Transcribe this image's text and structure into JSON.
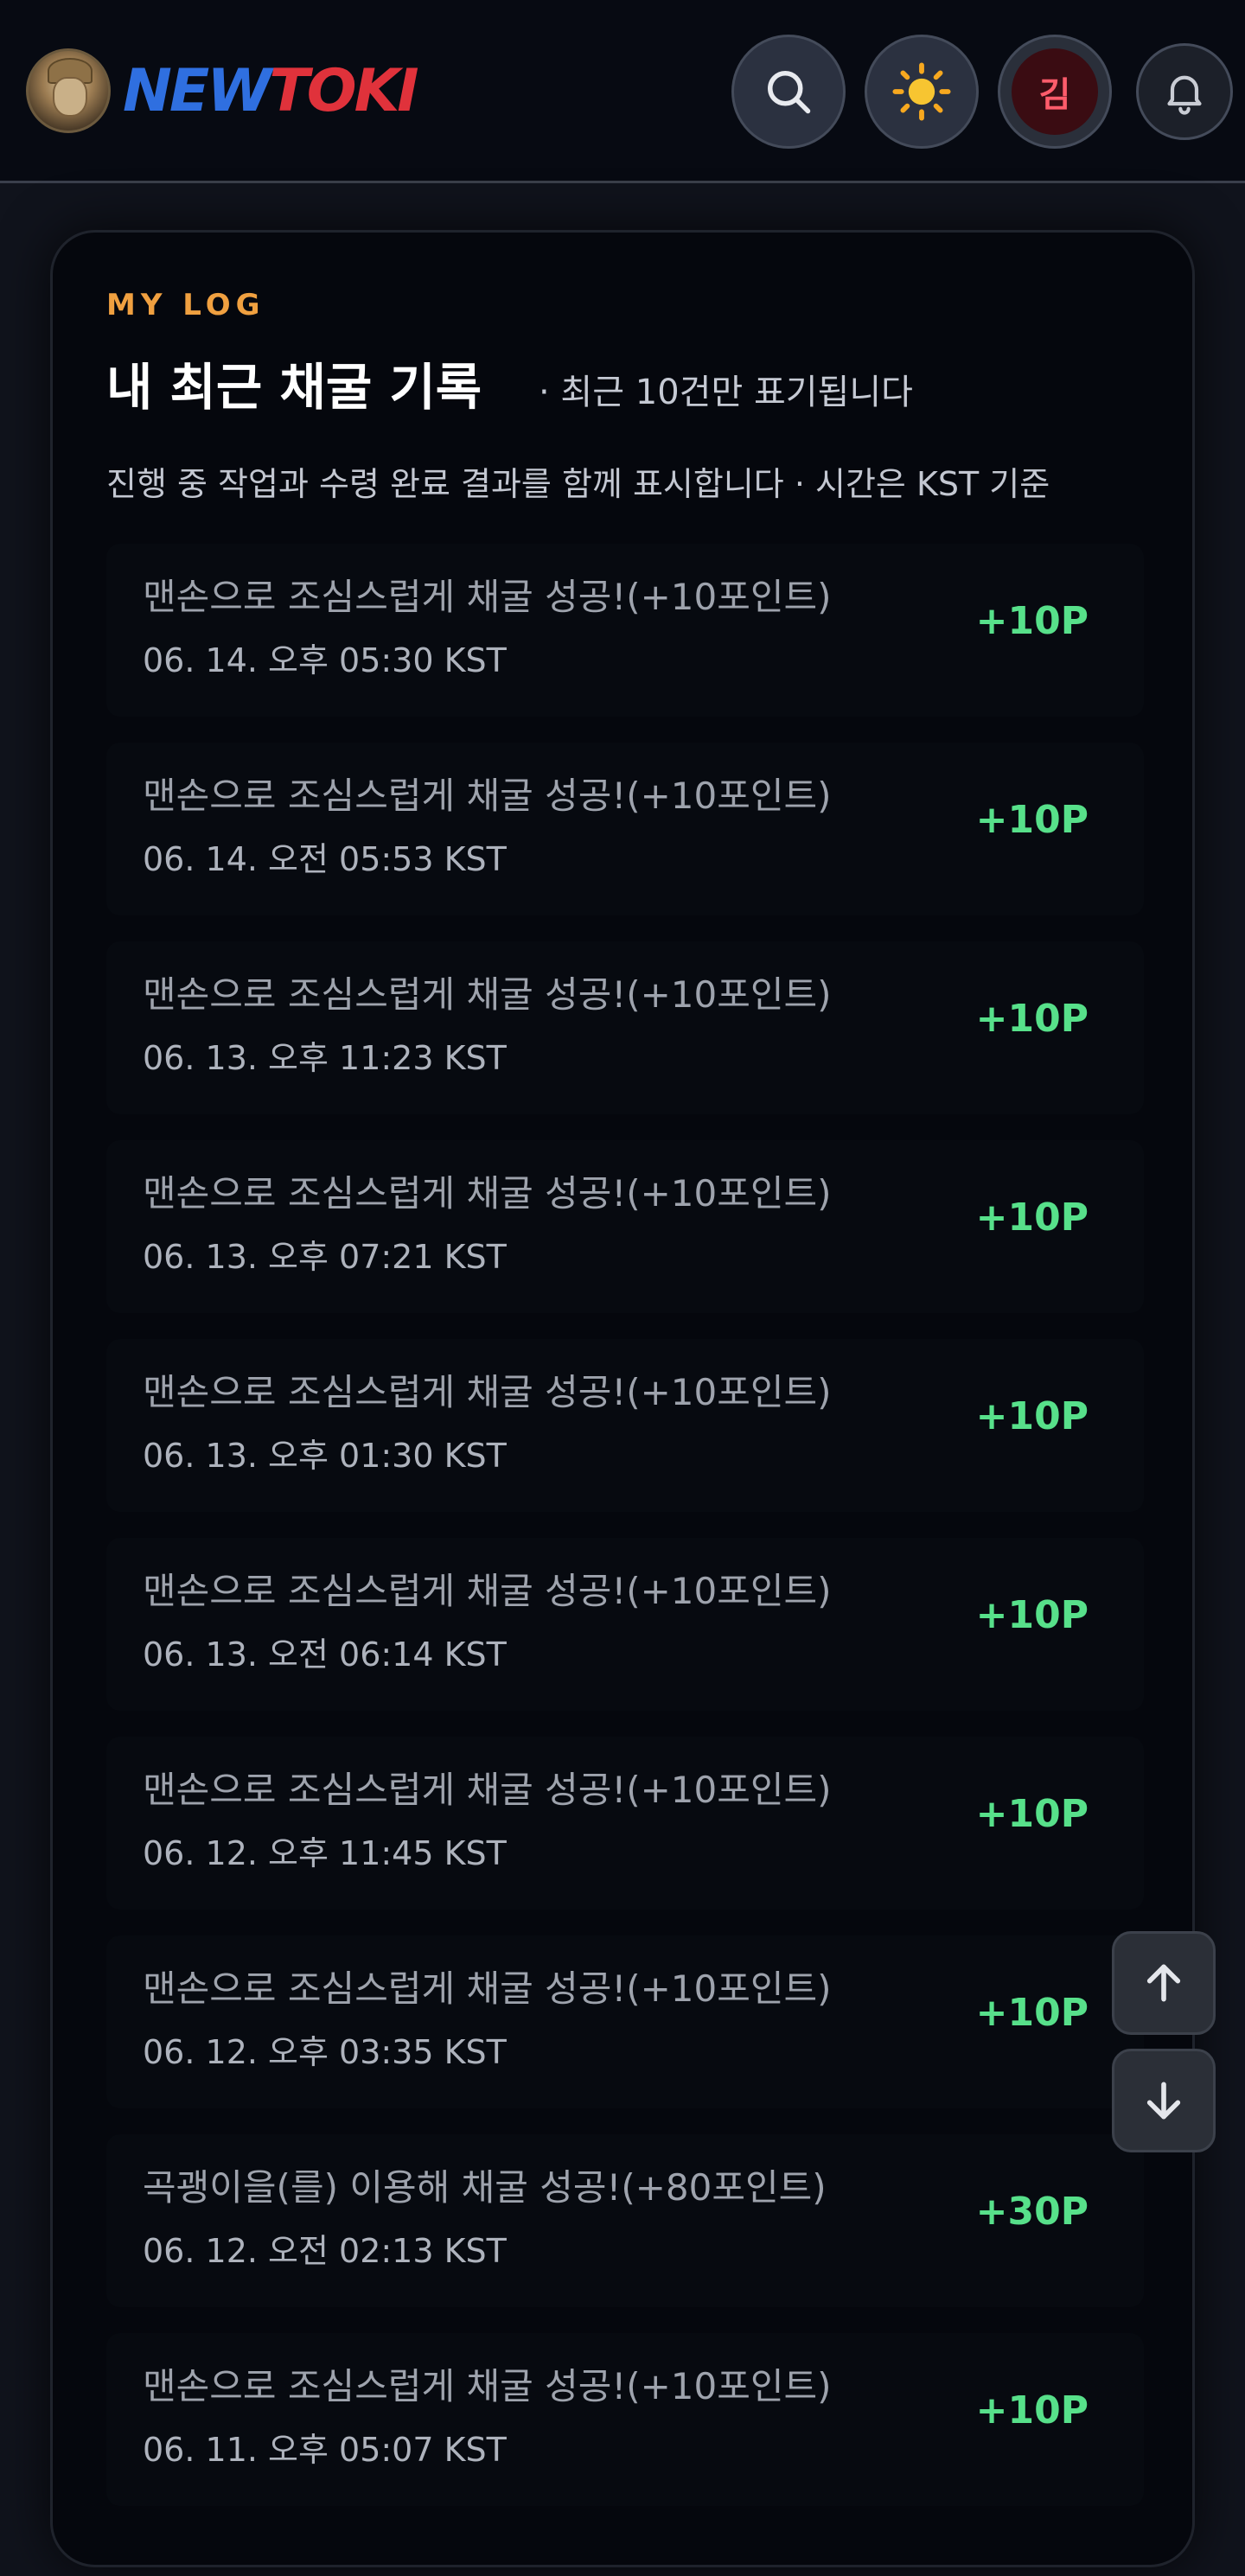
{
  "header": {
    "brand_part1": "NEW",
    "brand_part2": "TOKI",
    "user_initial": "김",
    "icons": [
      "search-icon",
      "sun-icon",
      "user-avatar",
      "bell-icon"
    ]
  },
  "log": {
    "eyebrow": "MY LOG",
    "title": "내 최근 채굴 기록",
    "title_note": "· 최근 10건만 표기됩니다",
    "subtitle": "진행 중 작업과 수령 완료 결과를 함께 표시합니다 · 시간은 KST 기준",
    "items": [
      {
        "title": "맨손으로 조심스럽게 채굴 성공!(+10포인트)",
        "time": "06. 14. 오후 05:30 KST",
        "points": "+10P"
      },
      {
        "title": "맨손으로 조심스럽게 채굴 성공!(+10포인트)",
        "time": "06. 14. 오전 05:53 KST",
        "points": "+10P"
      },
      {
        "title": "맨손으로 조심스럽게 채굴 성공!(+10포인트)",
        "time": "06. 13. 오후 11:23 KST",
        "points": "+10P"
      },
      {
        "title": "맨손으로 조심스럽게 채굴 성공!(+10포인트)",
        "time": "06. 13. 오후 07:21 KST",
        "points": "+10P"
      },
      {
        "title": "맨손으로 조심스럽게 채굴 성공!(+10포인트)",
        "time": "06. 13. 오후 01:30 KST",
        "points": "+10P"
      },
      {
        "title": "맨손으로 조심스럽게 채굴 성공!(+10포인트)",
        "time": "06. 13. 오전 06:14 KST",
        "points": "+10P"
      },
      {
        "title": "맨손으로 조심스럽게 채굴 성공!(+10포인트)",
        "time": "06. 12. 오후 11:45 KST",
        "points": "+10P"
      },
      {
        "title": "맨손으로 조심스럽게 채굴 성공!(+10포인트)",
        "time": "06. 12. 오후 03:35 KST",
        "points": "+10P"
      },
      {
        "title": "곡괭이을(를) 이용해 채굴 성공!(+80포인트)",
        "time": "06. 12. 오전 02:13 KST",
        "points": "+30P"
      },
      {
        "title": "맨손으로 조심스럽게 채굴 성공!(+10포인트)",
        "time": "06. 11. 오후 05:07 KST",
        "points": "+10P"
      }
    ]
  },
  "colors": {
    "accent_orange": "#f0a040",
    "points_green": "#57e08a",
    "brand_blue": "#2f6fe0",
    "brand_red": "#e0323b"
  }
}
